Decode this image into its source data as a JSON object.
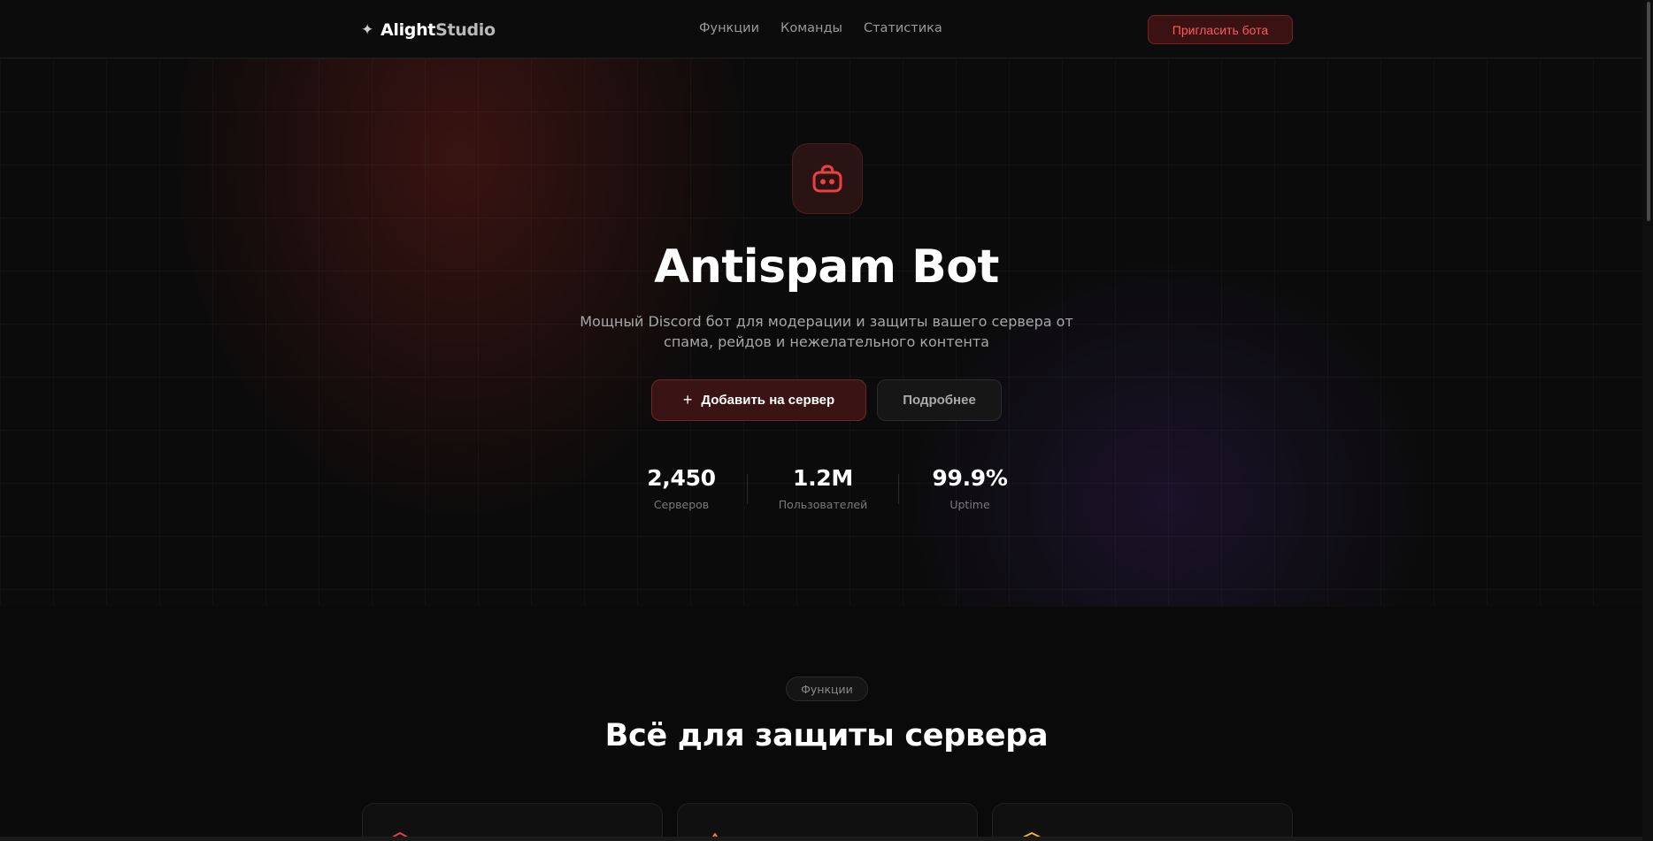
{
  "nav": {
    "logo_star": "✦",
    "logo_part1": "Alight",
    "logo_part2": "Studio",
    "links": [
      "Функции",
      "Команды",
      "Статистика"
    ],
    "invite_button": "Пригласить бота"
  },
  "hero": {
    "icon": "robot-icon",
    "title": "Antispam Bot",
    "subtitle_line1": "Мощный Discord бот для модерации и защиты вашего сервера от",
    "subtitle_line2": "спама, рейдов и нежелательного контента",
    "primary_button": "Добавить на сервер",
    "primary_button_icon": "+",
    "secondary_button": "Подробнее",
    "stats": [
      {
        "value": "2,450",
        "label": "Серверов"
      },
      {
        "value": "1.2M",
        "label": "Пользователей"
      },
      {
        "value": "99.9%",
        "label": "Uptime"
      }
    ]
  },
  "features": {
    "badge": "Функции",
    "title": "Всё для защиты сервера",
    "cards": [
      {
        "icon": "shield-icon"
      },
      {
        "icon": "warning-icon"
      },
      {
        "icon": "layers-icon"
      }
    ]
  },
  "colors": {
    "accent": "#e03a3a",
    "background": "#0a0a0a",
    "card_border": "#202020"
  }
}
